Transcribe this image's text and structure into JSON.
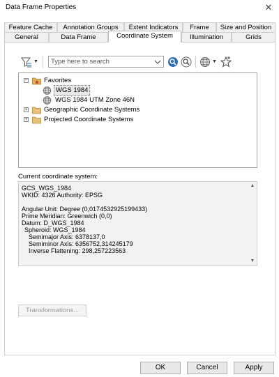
{
  "window": {
    "title": "Data Frame Properties"
  },
  "tabs_back": [
    {
      "label": "Feature Cache"
    },
    {
      "label": "Annotation Groups"
    },
    {
      "label": "Extent Indicators"
    },
    {
      "label": "Frame"
    },
    {
      "label": "Size and Position"
    }
  ],
  "tabs_front": [
    {
      "label": "General"
    },
    {
      "label": "Data Frame"
    },
    {
      "label": "Coordinate System"
    },
    {
      "label": "Illumination"
    },
    {
      "label": "Grids"
    }
  ],
  "toolbar": {
    "filter_icon": "filter-icon",
    "search_placeholder": "Type here to search",
    "search_icon": "search-icon",
    "search_fields_icon": "search-fields-icon",
    "globe_icon": "globe-icon",
    "star_icon": "add-favorite-icon"
  },
  "tree": {
    "items": [
      {
        "label": "Favorites",
        "expander": "−",
        "icon": "favorites-folder-icon"
      },
      {
        "label": "WGS 1984",
        "icon": "globe-icon"
      },
      {
        "label": "WGS 1984 UTM Zone 46N",
        "icon": "globe-icon"
      },
      {
        "label": "Geographic Coordinate Systems",
        "expander": "+",
        "icon": "folder-icon"
      },
      {
        "label": "Projected Coordinate Systems",
        "expander": "+",
        "icon": "folder-icon"
      }
    ]
  },
  "current": {
    "label": "Current coordinate system:",
    "lines": [
      "GCS_WGS_1984",
      "WKID: 4326 Authority: EPSG",
      "",
      "Angular Unit: Degree (0,0174532925199433)",
      "Prime Meridian: Greenwich (0,0)",
      "Datum: D_WGS_1984",
      "  Spheroid: WGS_1984",
      "    Semimajor Axis: 6378137,0",
      "    Semiminor Axis: 6356752,314245179",
      "    Inverse Flattening: 298,257223563"
    ]
  },
  "buttons": {
    "transformations": "Transformations...",
    "ok": "OK",
    "cancel": "Cancel",
    "apply": "Apply"
  },
  "colors": {
    "selection": "#e8e8e8",
    "globe": "#6a6a6a",
    "folder": "#d9a441",
    "search_blue": "#2f6db5"
  }
}
